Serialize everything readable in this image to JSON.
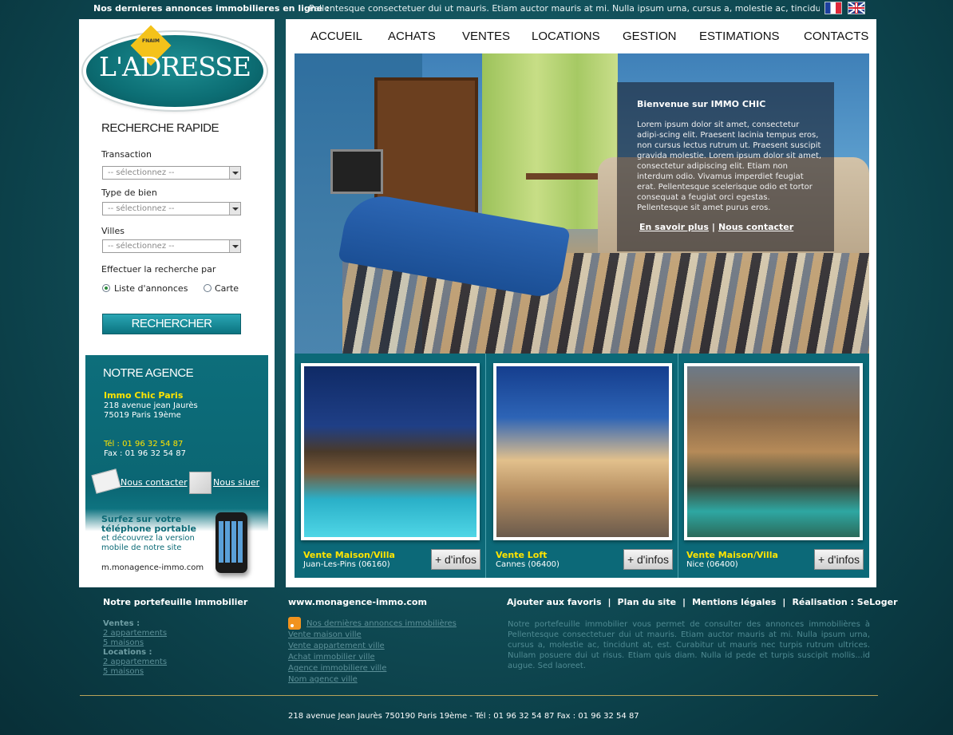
{
  "ticker": {
    "label": "Nos dernieres annonces immobilieres en ligne :",
    "text": "Pellentesque consectetuer dui ut mauris. Etiam auctor mauris at mi. Nulla ipsum urna, cursus a, molestie ac, tincidunt at, est. Cura..."
  },
  "languages": [
    "fr-flag-icon",
    "uk-flag-icon"
  ],
  "logo": {
    "badge": "FNAIM",
    "text": "L'ADRESSE"
  },
  "search": {
    "title": "RECHERCHE RAPIDE",
    "transaction_label": "Transaction",
    "type_label": "Type de bien",
    "villes_label": "Villes",
    "placeholder": "-- sélectionnez --",
    "mode_label": "Effectuer la recherche par",
    "mode_list": "Liste d'annonces",
    "mode_map": "Carte",
    "button": "RECHERCHER"
  },
  "agency": {
    "title": "NOTRE AGENCE",
    "name": "Immo Chic Paris",
    "address1": "218 avenue jean Jaurès",
    "address2": "75019 Paris 19ème",
    "tel": "Tél : 01 96 32 54 87",
    "fax": "Fax : 01 96 32 54 87",
    "contact_link": "Nous contacter",
    "locate_link": "Nous siuer",
    "mobile_title1": "Surfez sur votre",
    "mobile_title2": "téléphone portable",
    "mobile_text1": "et découvrez la version",
    "mobile_text2": "mobile de notre site",
    "mobile_url": "m.monagence-immo.com"
  },
  "nav": [
    "ACCUEIL",
    "ACHATS",
    "VENTES",
    "LOCATIONS",
    "GESTION",
    "ESTIMATIONS",
    "CONTACTS"
  ],
  "hero": {
    "title": "Bienvenue sur IMMO CHIC",
    "body": "Lorem ipsum dolor sit amet, consectetur adipi-scing elit. Praesent lacinia tempus eros, non cursus lectus rutrum ut. Praesent suscipit gravida molestie. Lorem ipsum dolor sit amet, consectetur adipiscing elit. Etiam non interdum odio. Vivamus imperdiet feugiat erat. Pellentesque scelerisque odio et tortor consequat a feugiat orci egestas. Pellentesque sit amet purus eros.",
    "link_more": "En savoir plus",
    "link_sep": "|",
    "link_contact": "Nous contacter"
  },
  "listings": [
    {
      "title": "Vente Maison/Villa",
      "location": "Juan-Les-Pins (06160)",
      "button": "+ d'infos"
    },
    {
      "title": "Vente Loft",
      "location": "Cannes (06400)",
      "button": "+ d'infos"
    },
    {
      "title": "Vente Maison/Villa",
      "location": "Nice (06400)",
      "button": "+ d'infos"
    }
  ],
  "footer": {
    "portfolio_title": "Notre portefeuille immobilier",
    "ventes_label": "Ventes :",
    "ventes_1": "2 appartements",
    "ventes_2": "5 maisons",
    "locations_label": "Locations :",
    "locations_1": "2 appartements",
    "locations_2": "5 maisons",
    "site_title": "www.monagence-immo.com",
    "site_links": [
      "Nos dernières annonces immobilières",
      "Vente maison ville",
      "Vente appartement ville",
      "Achat immobilier ville",
      "Agence immobiliere ville",
      "Nom agence ville"
    ],
    "links": [
      "Ajouter aux favoris",
      "Plan du site",
      "Mentions légales",
      "Réalisation : SeLoger"
    ],
    "about": "Notre portefeuille immobilier vous permet de consulter des annonces immobilières à Pellentesque consectetuer dui ut mauris. Etiam auctor mauris at mi. Nulla ipsum urna, cursus a, molestie ac, tincidunt at, est. Curabitur ut mauris nec turpis rutrum ultrices. Nullam posuere dui ut risus. Etiam quis diam. Nulla id pede et turpis suscipit mollis...id augue. Sed laoreet.",
    "address": "218 avenue Jean Jaurès 750190 Paris 19ème -  Tél : 01 96 32 54 87  Fax : 01 96 32 54 87"
  }
}
